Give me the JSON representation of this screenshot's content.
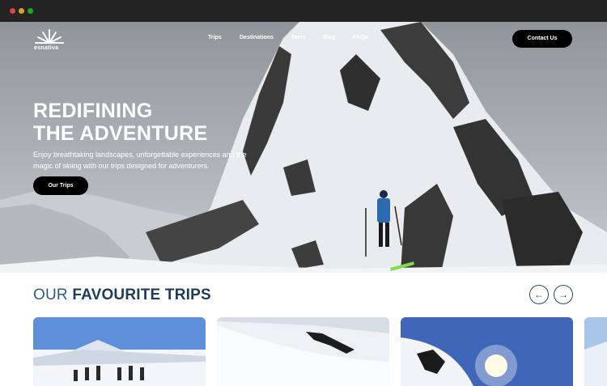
{
  "brand": {
    "name": "esnativa"
  },
  "nav": {
    "items": [
      "Trips",
      "Destinations",
      "Team",
      "Blog",
      "FAQs"
    ],
    "contact_label": "Contact Us"
  },
  "hero": {
    "title_line1": "REDIFINING",
    "title_line2": "THE ADVENTURE",
    "description": "Enjoy breathtaking landscapes, unforgettable experiences and the magic of skiing with our trips designed for adventurers.",
    "cta_label": "Our Trips"
  },
  "trips_section": {
    "title_light": "OUR",
    "title_bold": "FAVOURITE TRIPS",
    "prev_icon": "←",
    "next_icon": "→"
  },
  "colors": {
    "accent": "#1c3d5a",
    "button": "#000000"
  }
}
